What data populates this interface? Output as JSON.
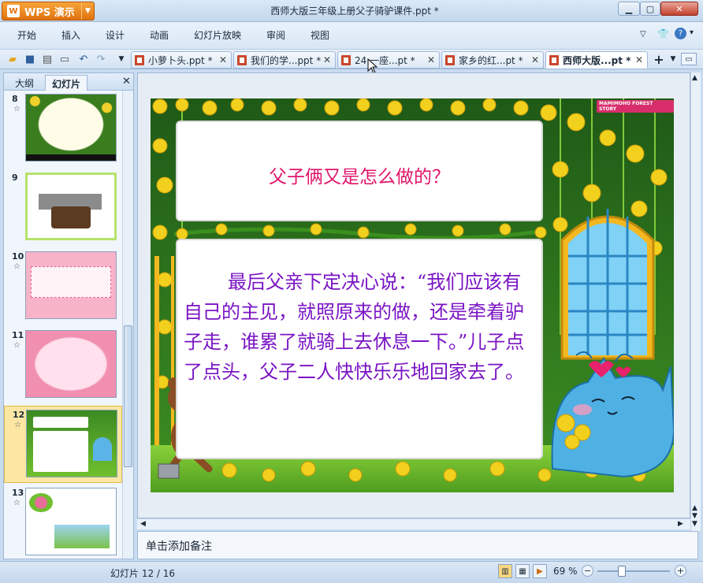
{
  "app": {
    "brand": "WPS 演示",
    "window_title": "西师大版三年级上册父子骑驴课件.ppt *"
  },
  "menu": [
    "开始",
    "插入",
    "设计",
    "动画",
    "幻灯片放映",
    "审阅",
    "视图"
  ],
  "doc_tabs": [
    {
      "label": "小萝卜头.ppt *"
    },
    {
      "label": "我们的学...ppt *"
    },
    {
      "label": "24 一座...pt *"
    },
    {
      "label": "家乡的红...pt *"
    },
    {
      "label": "西师大版...pt *",
      "active": true
    }
  ],
  "panel": {
    "tabs": [
      "大纲",
      "幻灯片"
    ],
    "slides": [
      {
        "number": "8",
        "star": "☆"
      },
      {
        "number": "9",
        "star": ""
      },
      {
        "number": "10",
        "star": "☆"
      },
      {
        "number": "11",
        "star": "☆"
      },
      {
        "number": "12",
        "star": "☆",
        "selected": true
      },
      {
        "number": "13",
        "star": "☆"
      }
    ]
  },
  "slide": {
    "title": "父子俩又是怎么做的？",
    "body": "最后父亲下定决心说：“我们应该有自己的主见，就照原来的做，还是牵着驴子走，谁累了就骑上去休息一下。”儿子点了点头，父子二人快快乐乐地回家去了。",
    "logo": "MAMIMOHO FOREST STORY"
  },
  "notes": {
    "placeholder": "单击添加备注"
  },
  "status": {
    "slide_counter": "幻灯片 12 / 16",
    "zoom": "69 %"
  },
  "colors": {
    "title_pink": "#e0156a",
    "body_purple": "#7a14c4",
    "brand_orange": "#e0720e"
  }
}
